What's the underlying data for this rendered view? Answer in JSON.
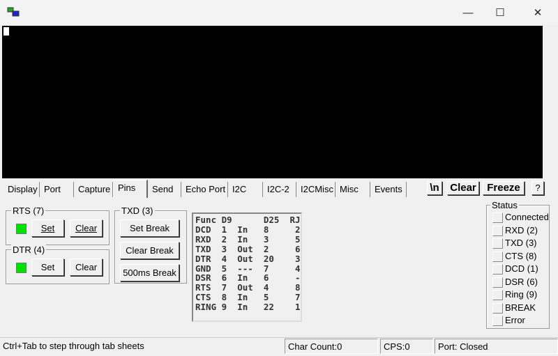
{
  "window": {
    "icon": "serial-port-icon",
    "minimize": "—",
    "maximize": "☐",
    "close": "✕"
  },
  "tabs": [
    "Display",
    "Port",
    "Capture",
    "Pins",
    "Send",
    "Echo Port",
    "I2C",
    "I2C-2",
    "I2CMisc",
    "Misc",
    "Events"
  ],
  "active_tab": "Pins",
  "toolbar": {
    "newline": "\\n",
    "clear": "Clear",
    "freeze": "Freeze",
    "help": "?"
  },
  "rts": {
    "label": "RTS (7)",
    "set": "Set",
    "clear": "Clear",
    "led": "#00e000"
  },
  "dtr": {
    "label": "DTR (4)",
    "set": "Set",
    "clear": "Clear",
    "led": "#00e000"
  },
  "txd": {
    "label": "TXD (3)",
    "set_break": "Set Break",
    "clear_break": "Clear Break",
    "break500": "500ms Break"
  },
  "pin_table": {
    "header": [
      "Func",
      "D9",
      "",
      "D25",
      "RJ"
    ],
    "rows": [
      [
        "DCD",
        "1",
        "In",
        "8",
        "2"
      ],
      [
        "RXD",
        "2",
        "In",
        "3",
        "5"
      ],
      [
        "TXD",
        "3",
        "Out",
        "2",
        "6"
      ],
      [
        "DTR",
        "4",
        "Out",
        "20",
        "3"
      ],
      [
        "GND",
        "5",
        "---",
        "7",
        "4"
      ],
      [
        "DSR",
        "6",
        "In",
        "6",
        "-"
      ],
      [
        "RTS",
        "7",
        "Out",
        "4",
        "8"
      ],
      [
        "CTS",
        "8",
        "In",
        "5",
        "7"
      ],
      [
        "RING",
        "9",
        "In",
        "22",
        "1"
      ]
    ]
  },
  "status": {
    "label": "Status",
    "items": [
      "Connected",
      "RXD (2)",
      "TXD (3)",
      "CTS (8)",
      "DCD (1)",
      "DSR (6)",
      "Ring (9)",
      "BREAK",
      "Error"
    ]
  },
  "statusbar": {
    "hint": "Ctrl+Tab to step through tab sheets",
    "char_count": "Char Count:0",
    "cps": "CPS:0",
    "port": "Port: Closed"
  }
}
